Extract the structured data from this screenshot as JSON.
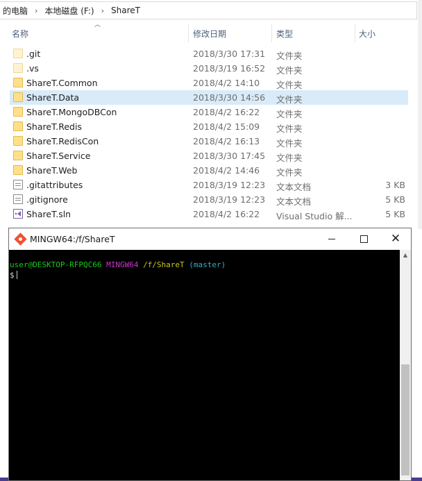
{
  "address_bar": {
    "crumbs": [
      "的电脑",
      "本地磁盘 (F:)",
      "ShareT"
    ],
    "separator": "›"
  },
  "columns": {
    "name": "名称",
    "modified": "修改日期",
    "type": "类型",
    "size": "大小"
  },
  "files": [
    {
      "name": ".git",
      "date": "2018/3/30 17:31",
      "type": "文件夹",
      "size": "",
      "icon": "folder-icon-hidden"
    },
    {
      "name": ".vs",
      "date": "2018/3/19 16:52",
      "type": "文件夹",
      "size": "",
      "icon": "folder-icon-hidden"
    },
    {
      "name": "ShareT.Common",
      "date": "2018/4/2 14:10",
      "type": "文件夹",
      "size": "",
      "icon": "folder-icon"
    },
    {
      "name": "ShareT.Data",
      "date": "2018/3/30 14:56",
      "type": "文件夹",
      "size": "",
      "icon": "folder-icon"
    },
    {
      "name": "ShareT.MongoDBCon",
      "date": "2018/4/2 16:22",
      "type": "文件夹",
      "size": "",
      "icon": "folder-icon"
    },
    {
      "name": "ShareT.Redis",
      "date": "2018/4/2 15:09",
      "type": "文件夹",
      "size": "",
      "icon": "folder-icon"
    },
    {
      "name": "ShareT.RedisCon",
      "date": "2018/4/2 16:13",
      "type": "文件夹",
      "size": "",
      "icon": "folder-icon"
    },
    {
      "name": "ShareT.Service",
      "date": "2018/3/30 17:45",
      "type": "文件夹",
      "size": "",
      "icon": "folder-icon"
    },
    {
      "name": "ShareT.Web",
      "date": "2018/4/2 14:46",
      "type": "文件夹",
      "size": "",
      "icon": "folder-icon"
    },
    {
      "name": ".gitattributes",
      "date": "2018/3/19 12:23",
      "type": "文本文档",
      "size": "3 KB",
      "icon": "text-file-icon"
    },
    {
      "name": ".gitignore",
      "date": "2018/3/19 12:23",
      "type": "文本文档",
      "size": "5 KB",
      "icon": "text-file-icon"
    },
    {
      "name": "ShareT.sln",
      "date": "2018/4/2 16:22",
      "type": "Visual Studio 解...",
      "size": "5 KB",
      "icon": "visual-studio-solution-icon"
    }
  ],
  "selected_file": "ShareT.Data",
  "terminal": {
    "title": "MINGW64:/f/ShareT",
    "prompt_user": "user@DESKTOP-RFPQC66",
    "prompt_system": "MINGW64",
    "prompt_path": "/f/ShareT",
    "prompt_branch": "(master)",
    "prompt_symbol": "$"
  },
  "colors": {
    "selection": "#d9ebf9",
    "term_green": "#1cc91c",
    "term_magenta": "#c837c8",
    "term_yellow": "#c8c81c",
    "term_cyan": "#26b3c8",
    "git_orange": "#f05133"
  }
}
